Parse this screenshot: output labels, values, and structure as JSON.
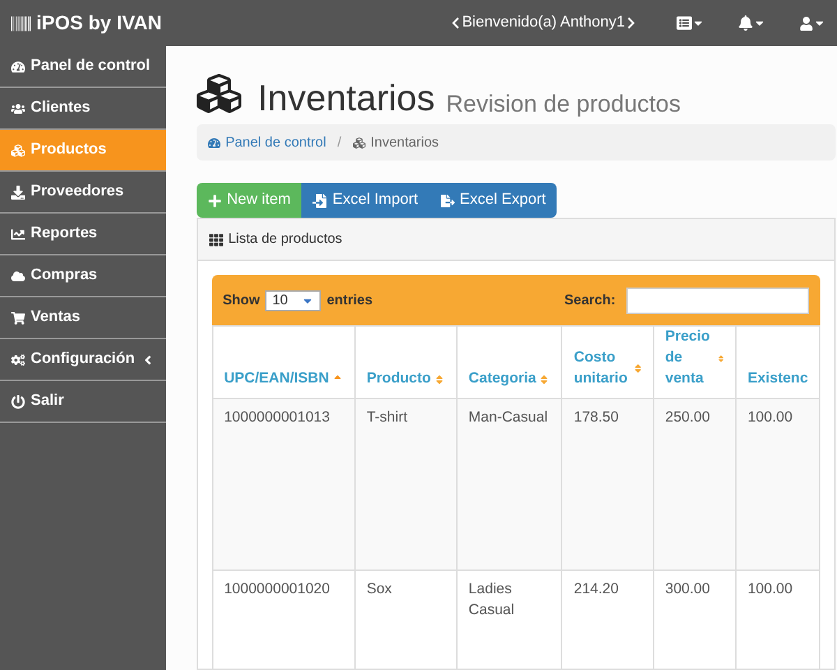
{
  "topbar": {
    "brand": "iPOS by IVAN",
    "welcome": "Bienvenido(a) Anthony1"
  },
  "sidebar": {
    "items": [
      {
        "label": "Panel de control",
        "kind": "dashboard",
        "selected": false,
        "submenu": false
      },
      {
        "label": "Clientes",
        "kind": "users",
        "selected": false,
        "submenu": false
      },
      {
        "label": "Productos",
        "kind": "cubes",
        "selected": true,
        "submenu": false
      },
      {
        "label": "Proveedores",
        "kind": "download",
        "selected": false,
        "submenu": false
      },
      {
        "label": "Reportes",
        "kind": "chart",
        "selected": false,
        "submenu": false
      },
      {
        "label": "Compras",
        "kind": "cloud",
        "selected": false,
        "submenu": false
      },
      {
        "label": "Ventas",
        "kind": "cart",
        "selected": false,
        "submenu": false
      },
      {
        "label": "Configuración",
        "kind": "cogs",
        "selected": false,
        "submenu": true
      },
      {
        "label": "Salir",
        "kind": "power",
        "selected": false,
        "submenu": false
      }
    ]
  },
  "page": {
    "title": "Inventarios",
    "subtitle": "Revision de productos"
  },
  "breadcrumb": {
    "separator": "/",
    "items": [
      {
        "label": "Panel de control",
        "kind": "dashboard"
      },
      {
        "label": "Inventarios",
        "kind": "cubes"
      }
    ]
  },
  "buttons": [
    {
      "label": "New item",
      "kind": "add"
    },
    {
      "label": "Excel Import",
      "kind": "import"
    },
    {
      "label": "Excel Export",
      "kind": "export"
    }
  ],
  "panel": {
    "title": "Lista de productos"
  },
  "table": {
    "show_label": "Show",
    "page_size": "10",
    "entries_label": "entries",
    "search_label": "Search:",
    "columns": [
      {
        "label": "UPC/EAN/ISBN",
        "kind": "sorted"
      },
      {
        "label": "Producto",
        "kind": "sortable"
      },
      {
        "label": "Categoria",
        "kind": "sortable"
      },
      {
        "label": "Costo unitario",
        "kind": "sortable"
      },
      {
        "label": "Precio de venta",
        "kind": "sortable"
      },
      {
        "label": "Existenc",
        "kind": "plain"
      }
    ],
    "rows": [
      [
        "1000000001013",
        "T-shirt",
        "Man-Casual",
        "178.50",
        "250.00",
        "100.00"
      ],
      [
        "1000000001020",
        "Sox",
        "Ladies Casual",
        "214.20",
        "300.00",
        "100.00"
      ]
    ]
  }
}
